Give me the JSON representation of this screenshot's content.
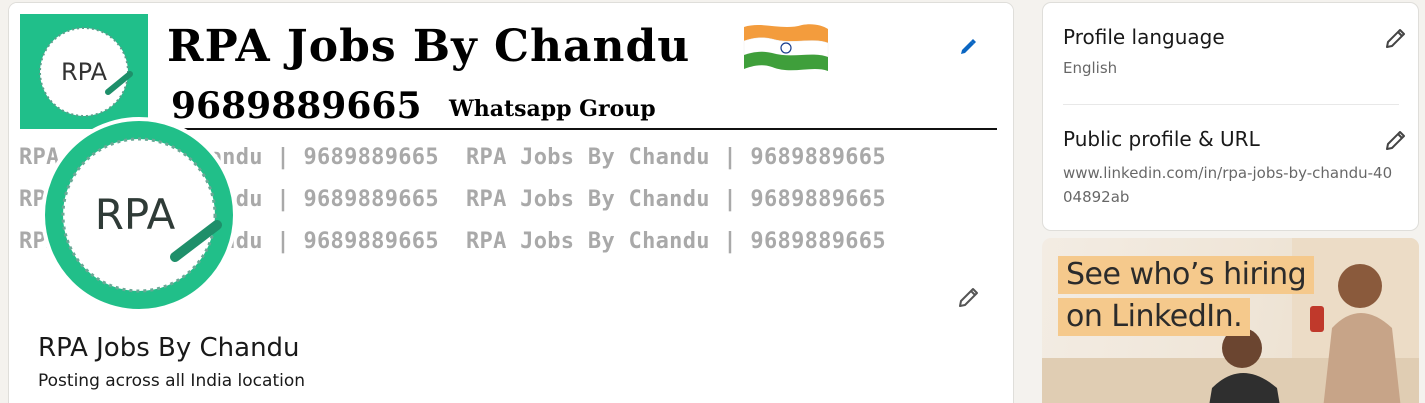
{
  "banner": {
    "logo_text": "RPA",
    "title": "RPA Jobs By Chandu",
    "phone": "9689889665",
    "group": "Whatsapp Group",
    "watermark_rows": [
      "RPA Jobs By Chandu | 9689889665  RPA Jobs By Chandu | 9689889665",
      "RPA Jobs By Chandu | 9689889665  RPA Jobs By Chandu | 9689889665",
      "RPA Jobs By Chandu | 9689889665  RPA Jobs By Chandu | 9689889665"
    ]
  },
  "profile": {
    "avatar_text": "RPA",
    "name": "RPA Jobs By Chandu",
    "headline": "Posting across all India location"
  },
  "sidebar": {
    "language_title": "Profile language",
    "language_value": "English",
    "url_title": "Public profile & URL",
    "url_value": "www.linkedin.com/in/rpa-jobs-by-chandu-4004892ab"
  },
  "ad": {
    "line1": "See who’s hiring",
    "line2": "on LinkedIn."
  },
  "colors": {
    "brand_green": "#20bf8a",
    "linkedin_blue": "#0a66c2",
    "ad_highlight": "#f5c98c"
  },
  "icons": [
    "pencil-icon",
    "india-flag-icon"
  ]
}
